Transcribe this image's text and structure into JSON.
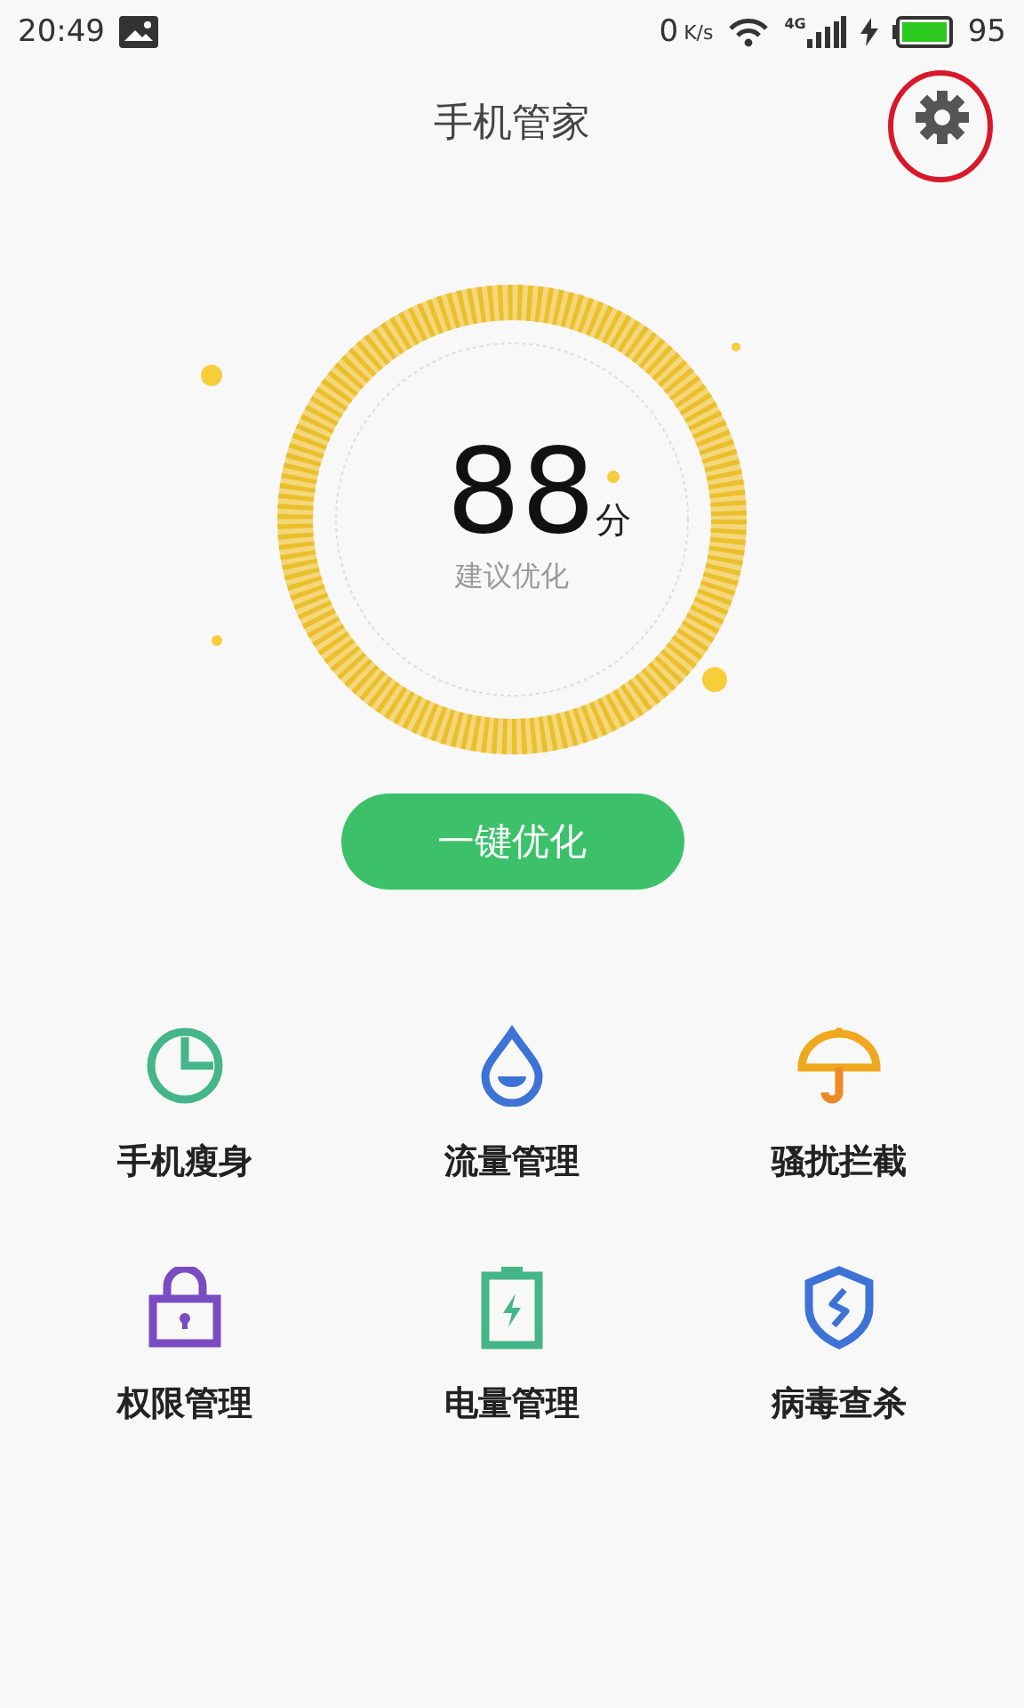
{
  "status_bar": {
    "time": "20:49",
    "speed": "0",
    "speed_unit": "K/s",
    "network": "4G",
    "battery": "95"
  },
  "header": {
    "title": "手机管家"
  },
  "score": {
    "value": "88",
    "unit": "分",
    "hint": "建议优化"
  },
  "action_button": {
    "label": "一键优化"
  },
  "tools": [
    {
      "kind": "cleanup",
      "label": "手机瘦身"
    },
    {
      "kind": "data",
      "label": "流量管理"
    },
    {
      "kind": "block",
      "label": "骚扰拦截"
    },
    {
      "kind": "permission",
      "label": "权限管理"
    },
    {
      "kind": "battery",
      "label": "电量管理"
    },
    {
      "kind": "virus",
      "label": "病毒查杀"
    }
  ]
}
